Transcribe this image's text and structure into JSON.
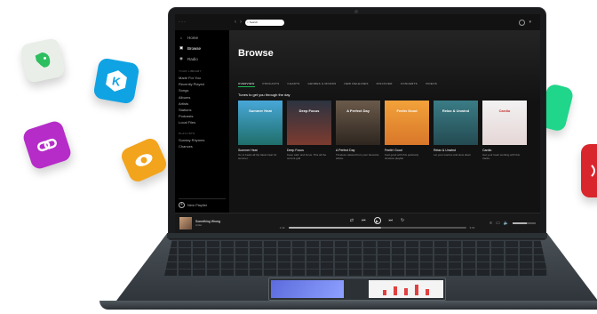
{
  "app": {
    "search_placeholder": "Search",
    "nav": [
      "Home",
      "Browse",
      "Radio"
    ],
    "library_header": "YOUR LIBRARY",
    "library_items": [
      "Made For You",
      "Recently Played",
      "Songs",
      "Albums",
      "Artists",
      "Stations",
      "Podcasts",
      "Local Files"
    ],
    "playlists_header": "PLAYLISTS",
    "playlist_items": [
      "Sunday Rhymes",
      "Chances"
    ],
    "new_playlist_label": "New Playlist"
  },
  "browse": {
    "title": "Browse",
    "tabs": [
      "OVERVIEW",
      "PODCASTS",
      "CHARTS",
      "GENRES & MOODS",
      "NEW RELEASES",
      "DISCOVER",
      "CONCERTS",
      "VIDEOS"
    ],
    "active_tab": "OVERVIEW",
    "section_title": "Tunes to get you through the day",
    "cards": [
      {
        "cover_text": "Summer Heat",
        "title": "Summer Heat",
        "desc": "Go to beats all the latest heat for summer.",
        "colors": [
          "#48a7d8",
          "#1f6f6a"
        ]
      },
      {
        "cover_text": "Deep Focus",
        "title": "Deep Focus",
        "desc": "Keep calm and focus. This all the current grid",
        "colors": [
          "#2c3340",
          "#7d3b2f"
        ]
      },
      {
        "cover_text": "A Perfect Day",
        "title": "A Perfect Day",
        "desc": "Timeless relaxed from your favourite artists.",
        "colors": [
          "#6a5a4a",
          "#2e2620"
        ]
      },
      {
        "cover_text": "Feelin Good",
        "title": "Feelin' Good",
        "desc": "Feel good with this positively timeless playlist",
        "colors": [
          "#f2a23a",
          "#d9772a"
        ]
      },
      {
        "cover_text": "Relax & Unwind",
        "title": "Relax & Unwind",
        "desc": "Let your worries and slow down",
        "colors": [
          "#3a7c86",
          "#244b52"
        ]
      },
      {
        "cover_text": "Cardio",
        "title": "Cardio",
        "desc": "Get your heart working with this tracks.",
        "colors": [
          "#f2f2f2",
          "#e6d6d6"
        ]
      }
    ]
  },
  "player": {
    "track": "Something Wrong",
    "artist": "Artist",
    "time_elapsed": "1:42",
    "time_total": "3:15",
    "progress": 0.52,
    "volume": 0.6
  },
  "brand_colors": {
    "accent": "#1db954",
    "background": "#121212"
  },
  "floating_icons": [
    "evernote-icon",
    "kkbox-icon",
    "link-icon",
    "eye-icon",
    "green-app-icon",
    "red-app-icon"
  ]
}
